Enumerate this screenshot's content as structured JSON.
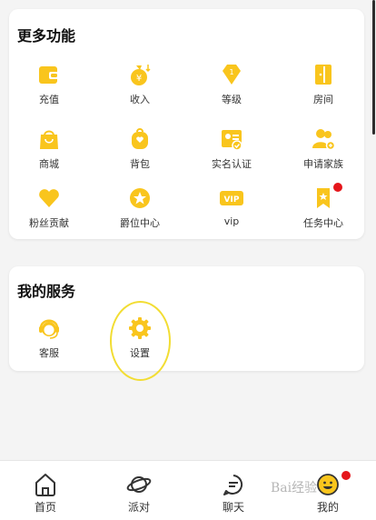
{
  "colors": {
    "accent": "#f9c51d",
    "badge": "#e5161b",
    "highlight": "#f2dd33"
  },
  "more_features": {
    "title": "更多功能",
    "items": [
      {
        "label": "充值",
        "icon": "wallet-icon"
      },
      {
        "label": "收入",
        "icon": "money-bag-icon"
      },
      {
        "label": "等级",
        "icon": "diamond-icon"
      },
      {
        "label": "房间",
        "icon": "door-icon"
      },
      {
        "label": "商城",
        "icon": "shopping-bag-icon"
      },
      {
        "label": "背包",
        "icon": "backpack-icon"
      },
      {
        "label": "实名认证",
        "icon": "id-card-icon"
      },
      {
        "label": "申请家族",
        "icon": "family-icon"
      },
      {
        "label": "粉丝贡献",
        "icon": "heart-icon"
      },
      {
        "label": "爵位中心",
        "icon": "star-badge-icon"
      },
      {
        "label": "vip",
        "icon": "vip-icon"
      },
      {
        "label": "任务中心",
        "icon": "task-flag-icon"
      }
    ]
  },
  "my_services": {
    "title": "我的服务",
    "items": [
      {
        "label": "客服",
        "icon": "customer-service-icon"
      },
      {
        "label": "设置",
        "icon": "gear-icon"
      }
    ]
  },
  "tabbar": {
    "items": [
      {
        "label": "首页",
        "icon": "home-icon"
      },
      {
        "label": "派对",
        "icon": "planet-icon"
      },
      {
        "label": "聊天",
        "icon": "chat-icon"
      },
      {
        "label": "我的",
        "icon": "smiley-icon"
      }
    ]
  },
  "watermark": "Bai经验"
}
